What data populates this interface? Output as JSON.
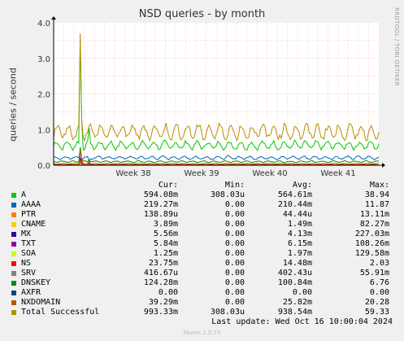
{
  "title": "NSD queries - by month",
  "ylabel": "queries / second",
  "watermark": "RRDTOOL / TOBI OETIKER",
  "footer": "Munin 2.0.73",
  "last_update": "Last update: Wed Oct 16 10:00:04 2024",
  "legend_headers": {
    "cur": "Cur:",
    "min": "Min:",
    "avg": "Avg:",
    "max": "Max:"
  },
  "colors": {
    "background": "#f0f0f0",
    "plot": "#ffffff",
    "grid": "#ff9a9a",
    "axis": "#000000"
  },
  "chart_data": {
    "type": "line",
    "title": "NSD queries - by month",
    "ylabel": "queries / second",
    "ylim": [
      0,
      4.0
    ],
    "yticks": [
      "0.0",
      "1.0",
      "2.0",
      "3.0",
      "4.0"
    ],
    "xticks": [
      "Week 38",
      "Week 39",
      "Week 40",
      "Week 41"
    ],
    "grid": true,
    "series": [
      {
        "name": "A",
        "color": "#00cc00",
        "approx_level": 0.56,
        "noise": 0.1,
        "spike": 3.5
      },
      {
        "name": "AAAA",
        "color": "#0066b3",
        "approx_level": 0.21,
        "noise": 0.04,
        "spike": 0.4
      },
      {
        "name": "PTR",
        "color": "#ff8000",
        "approx_level": 0.045,
        "noise": 0.01,
        "spike": 0.12
      },
      {
        "name": "CNAME",
        "color": "#ffcc00",
        "approx_level": 0.0015,
        "noise": 0.0,
        "spike": 0.08
      },
      {
        "name": "MX",
        "color": "#330099",
        "approx_level": 0.004,
        "noise": 0.0,
        "spike": 0.2
      },
      {
        "name": "TXT",
        "color": "#990099",
        "approx_level": 0.006,
        "noise": 0.0,
        "spike": 0.1
      },
      {
        "name": "SOA",
        "color": "#ccff00",
        "approx_level": 0.002,
        "noise": 0.0,
        "spike": 0.12
      },
      {
        "name": "NS",
        "color": "#ff0000",
        "approx_level": 0.015,
        "noise": 0.003,
        "spike": 0.15
      },
      {
        "name": "SRV",
        "color": "#808080",
        "approx_level": 0.0004,
        "noise": 0.0,
        "spike": 0.05
      },
      {
        "name": "DNSKEY",
        "color": "#008f00",
        "approx_level": 0.1,
        "noise": 0.02,
        "spike": 0.5
      },
      {
        "name": "AXFR",
        "color": "#00487d",
        "approx_level": 0.0,
        "noise": 0.0,
        "spike": 0.0
      },
      {
        "name": "NXDOMAIN",
        "color": "#b35a00",
        "approx_level": 0.026,
        "noise": 0.008,
        "spike": 0.4
      },
      {
        "name": "Total Successful",
        "color": "#b38f00",
        "approx_level": 0.94,
        "noise": 0.18,
        "spike": 3.7
      }
    ],
    "legend": [
      {
        "name": "A",
        "color": "#00cc00",
        "cur": "594.08m",
        "min": "308.03u",
        "avg": "564.61m",
        "max": "38.94"
      },
      {
        "name": "AAAA",
        "color": "#0066b3",
        "cur": "219.27m",
        "min": "0.00",
        "avg": "210.44m",
        "max": "11.87"
      },
      {
        "name": "PTR",
        "color": "#ff8000",
        "cur": "138.89u",
        "min": "0.00",
        "avg": "44.44u",
        "max": "13.11m"
      },
      {
        "name": "CNAME",
        "color": "#ffcc00",
        "cur": "3.89m",
        "min": "0.00",
        "avg": "1.49m",
        "max": "82.27m"
      },
      {
        "name": "MX",
        "color": "#330099",
        "cur": "5.56m",
        "min": "0.00",
        "avg": "4.13m",
        "max": "227.03m"
      },
      {
        "name": "TXT",
        "color": "#990099",
        "cur": "5.84m",
        "min": "0.00",
        "avg": "6.15m",
        "max": "108.26m"
      },
      {
        "name": "SOA",
        "color": "#ccff00",
        "cur": "1.25m",
        "min": "0.00",
        "avg": "1.97m",
        "max": "129.58m"
      },
      {
        "name": "NS",
        "color": "#ff0000",
        "cur": "23.75m",
        "min": "0.00",
        "avg": "14.48m",
        "max": "2.03"
      },
      {
        "name": "SRV",
        "color": "#808080",
        "cur": "416.67u",
        "min": "0.00",
        "avg": "402.43u",
        "max": "55.91m"
      },
      {
        "name": "DNSKEY",
        "color": "#008f00",
        "cur": "124.28m",
        "min": "0.00",
        "avg": "100.84m",
        "max": "6.76"
      },
      {
        "name": "AXFR",
        "color": "#00487d",
        "cur": "0.00",
        "min": "0.00",
        "avg": "0.00",
        "max": "0.00"
      },
      {
        "name": "NXDOMAIN",
        "color": "#b35a00",
        "cur": "39.29m",
        "min": "0.00",
        "avg": "25.82m",
        "max": "20.28"
      },
      {
        "name": "Total Successful",
        "color": "#b38f00",
        "cur": "993.33m",
        "min": "308.03u",
        "avg": "938.54m",
        "max": "59.33"
      }
    ]
  }
}
